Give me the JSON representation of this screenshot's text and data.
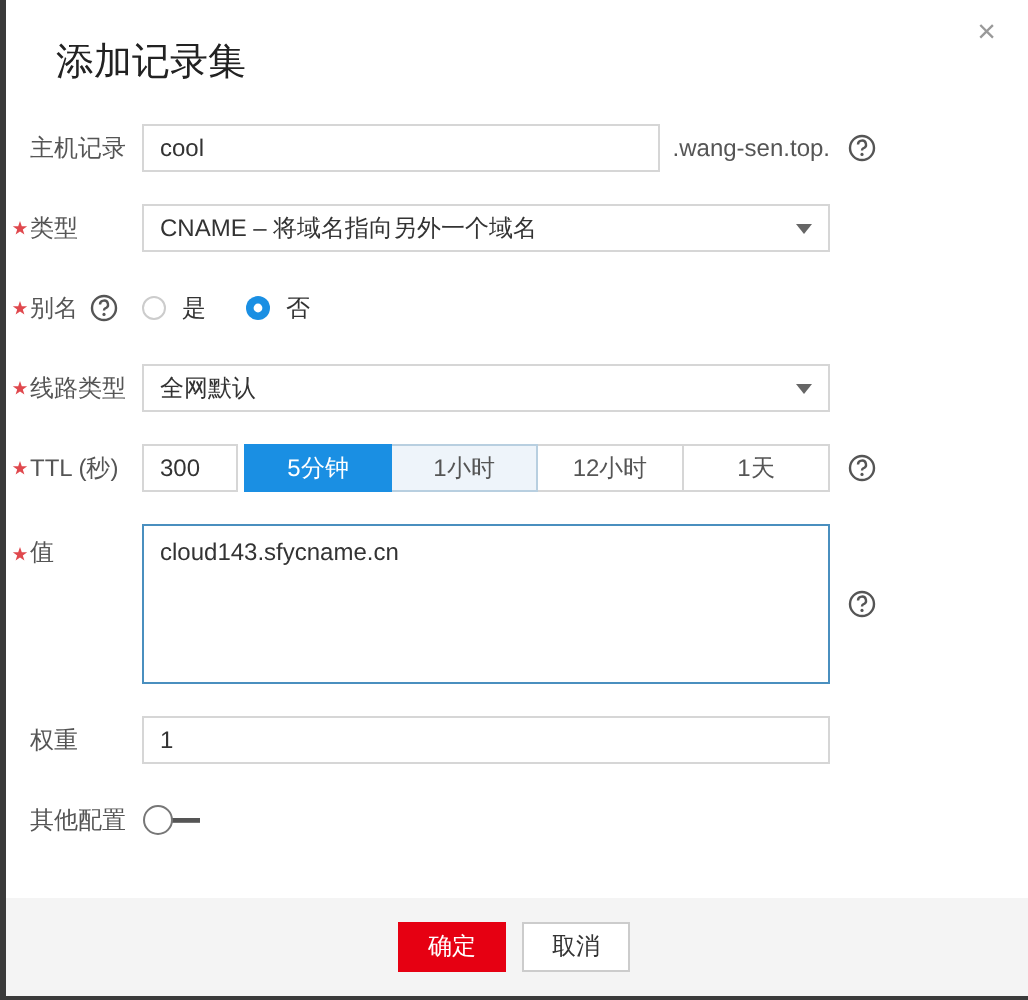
{
  "dialog": {
    "title": "添加记录集",
    "close": "×"
  },
  "fields": [
    {
      "kind": "text",
      "label": "主机记录",
      "required": false,
      "value": "cool",
      "suffix": ".wang-sen.top.",
      "help": true
    },
    {
      "kind": "select",
      "label": "类型",
      "required": true,
      "value": "CNAME – 将域名指向另外一个域名"
    },
    {
      "kind": "radio",
      "label": "别名",
      "required": true,
      "label_help": true,
      "options": [
        {
          "label": "是",
          "selected": false
        },
        {
          "label": "否",
          "selected": true
        }
      ]
    },
    {
      "kind": "select",
      "label": "线路类型",
      "required": true,
      "value": "全网默认"
    },
    {
      "kind": "ttl",
      "label": "TTL (秒)",
      "required": true,
      "value": "300",
      "help": true,
      "presets": [
        {
          "label": "5分钟",
          "selected": true,
          "hovered": false
        },
        {
          "label": "1小时",
          "selected": false,
          "hovered": true
        },
        {
          "label": "12小时",
          "selected": false,
          "hovered": false
        },
        {
          "label": "1天",
          "selected": false,
          "hovered": false
        }
      ]
    },
    {
      "kind": "textarea",
      "label": "值",
      "required": true,
      "value": "cloud143.sfycname.cn",
      "help": true
    },
    {
      "kind": "text",
      "label": "权重",
      "required": false,
      "value": "1"
    },
    {
      "kind": "toggle",
      "label": "其他配置",
      "required": false,
      "on": false
    }
  ],
  "buttons": [
    {
      "label": "确定",
      "kind": "primary"
    },
    {
      "label": "取消",
      "kind": "secondary"
    }
  ]
}
